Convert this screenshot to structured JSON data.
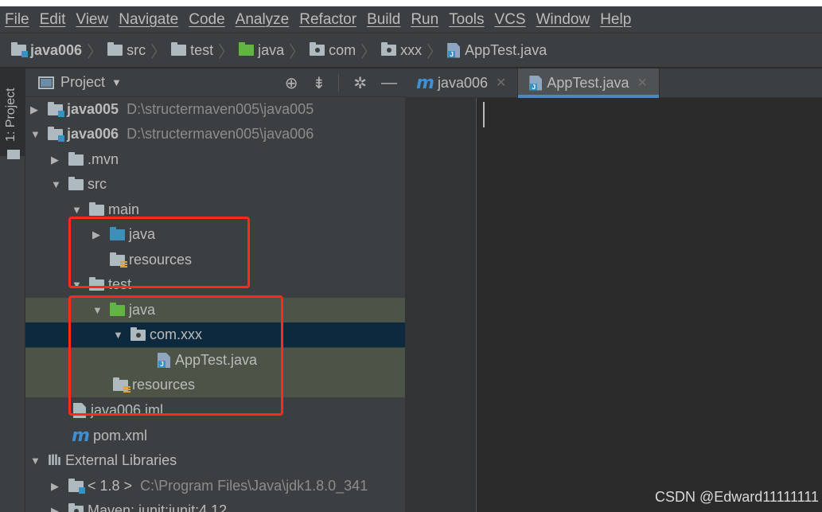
{
  "menu": [
    "File",
    "Edit",
    "View",
    "Navigate",
    "Code",
    "Analyze",
    "Refactor",
    "Build",
    "Run",
    "Tools",
    "VCS",
    "Window",
    "Help"
  ],
  "breadcrumb": [
    "java006",
    "src",
    "test",
    "java",
    "com",
    "xxx",
    "AppTest.java"
  ],
  "sidebar_tab": "1: Project",
  "project_panel": {
    "title": "Project",
    "tree": [
      {
        "label": "java005",
        "path": "D:\\structermaven005\\java005"
      },
      {
        "label": "java006",
        "path": "D:\\structermaven005\\java006"
      },
      {
        "label": ".mvn"
      },
      {
        "label": "src"
      },
      {
        "label": "main"
      },
      {
        "label": "java"
      },
      {
        "label": "resources"
      },
      {
        "label": "test"
      },
      {
        "label": "java"
      },
      {
        "label": "com.xxx"
      },
      {
        "label": "AppTest.java"
      },
      {
        "label": "resources"
      },
      {
        "label": "java006.iml"
      },
      {
        "label": "pom.xml"
      },
      {
        "label": "External Libraries"
      },
      {
        "label": "< 1.8 >",
        "path": "C:\\Program Files\\Java\\jdk1.8.0_341"
      },
      {
        "label": "Maven: junit:junit:4.12"
      }
    ]
  },
  "editor_tabs": [
    {
      "label": "java006",
      "active": false
    },
    {
      "label": "AppTest.java",
      "active": true
    }
  ],
  "watermark": "CSDN @Edward11111111",
  "colors": {
    "annotation": "#ff2a1a",
    "selection": "#0d293e",
    "highlight": "#4b5446"
  }
}
